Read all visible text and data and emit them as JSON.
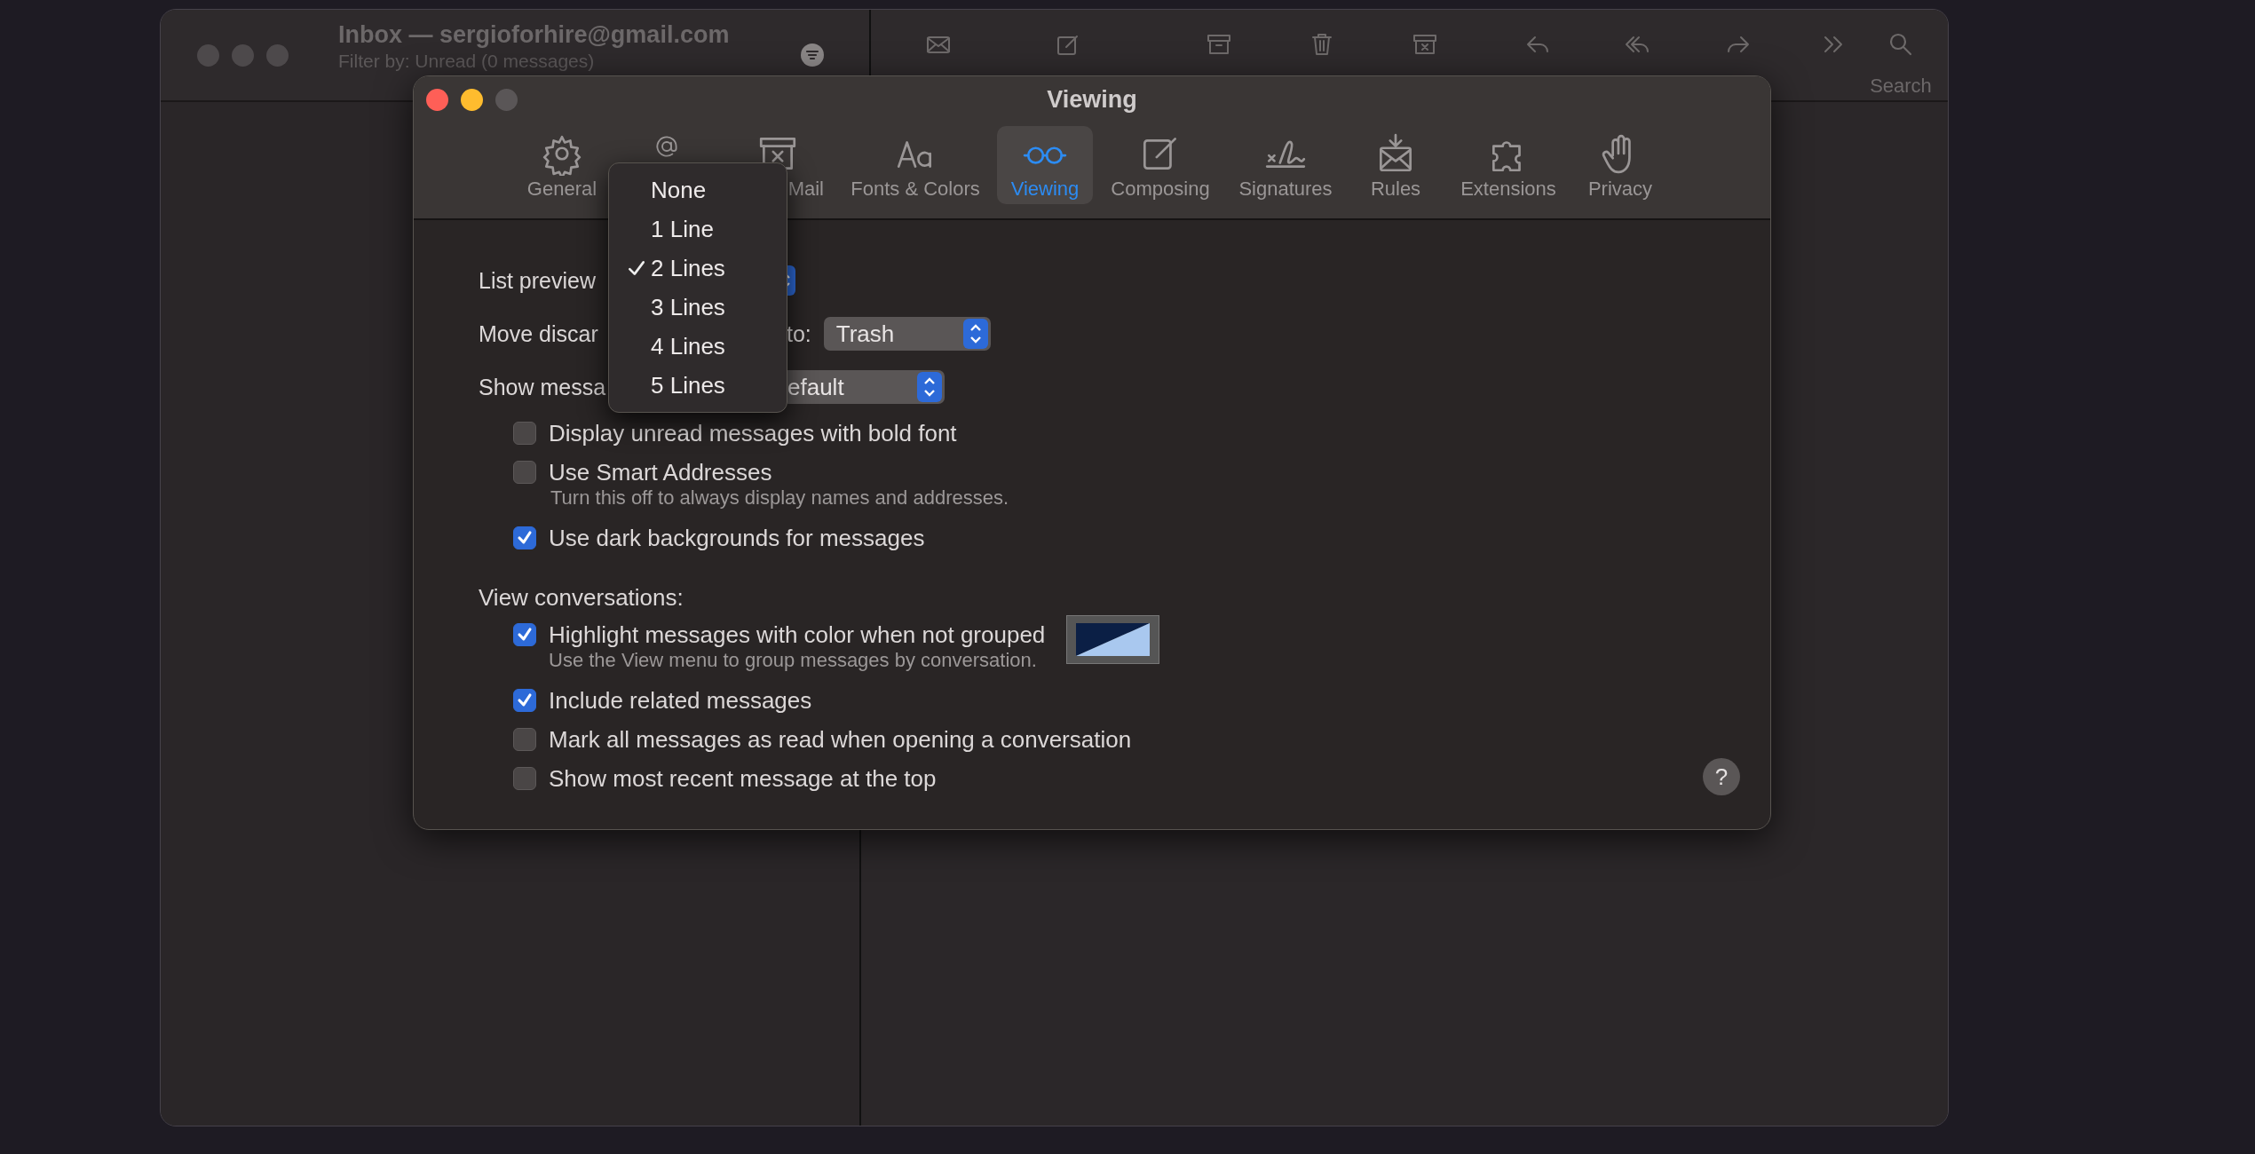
{
  "mail_window": {
    "title": "Inbox — sergioforhire@gmail.com",
    "subtitle": "Filter by: Unread (0 messages)",
    "search_label": "Search"
  },
  "preferences": {
    "title": "Viewing",
    "tabs": [
      {
        "kind": "gear",
        "label": "General",
        "selected": false
      },
      {
        "kind": "at",
        "selected": false
      },
      {
        "kind": "junk",
        "label": "Mail",
        "selected": false
      },
      {
        "kind": "fonts",
        "label": "Fonts & Colors",
        "selected": false
      },
      {
        "kind": "glasses",
        "label": "Viewing",
        "selected": true
      },
      {
        "kind": "compose",
        "label": "Composing",
        "selected": false
      },
      {
        "kind": "signature",
        "label": "Signatures",
        "selected": false
      },
      {
        "kind": "rules",
        "label": "Rules",
        "selected": false
      },
      {
        "kind": "puzzle",
        "label": "Extensions",
        "selected": false
      },
      {
        "kind": "hand",
        "label": "Privacy",
        "selected": false
      }
    ],
    "list_preview_label": "List preview",
    "move_discarded_label": "Move discar",
    "move_discarded_suffix": "to:",
    "move_discarded_value": "Trash",
    "show_message_label": "Show messa",
    "show_message_value": "efault",
    "options": [
      {
        "label": "Display unread messages with bold font",
        "checked": false
      },
      {
        "label": "Use Smart Addresses",
        "checked": false,
        "hint": "Turn this off to always display names and addresses."
      },
      {
        "label": "Use dark backgrounds for messages",
        "checked": true
      }
    ],
    "view_conversations_label": "View conversations:",
    "conversation_options": [
      {
        "label": "Highlight messages with color when not grouped",
        "checked": true,
        "hint": "Use the View menu to group messages by conversation.",
        "color_well": true
      },
      {
        "label": "Include related messages",
        "checked": true
      },
      {
        "label": "Mark all messages as read when opening a conversation",
        "checked": false
      },
      {
        "label": "Show most recent message at the top",
        "checked": false
      }
    ],
    "help_label": "?"
  },
  "list_preview_menu": {
    "items": [
      {
        "label": "None",
        "selected": false
      },
      {
        "label": "1 Line",
        "selected": false
      },
      {
        "label": "2 Lines",
        "selected": true
      },
      {
        "label": "3 Lines",
        "selected": false
      },
      {
        "label": "4 Lines",
        "selected": false
      },
      {
        "label": "5 Lines",
        "selected": false
      }
    ]
  }
}
